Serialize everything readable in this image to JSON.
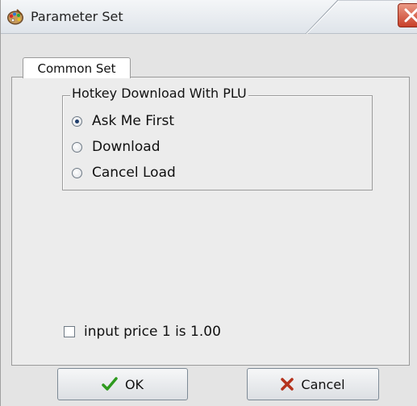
{
  "window": {
    "title": "Parameter Set",
    "app_icon": "palette-icon",
    "close_icon": "close-icon"
  },
  "tabs": [
    {
      "label": "Common Set",
      "active": true
    }
  ],
  "hotkey_group": {
    "legend": "Hotkey Download With PLU",
    "options": [
      {
        "label": "Ask Me First",
        "checked": true
      },
      {
        "label": "Download",
        "checked": false
      },
      {
        "label": "Cancel Load",
        "checked": false
      }
    ]
  },
  "input_price_option": {
    "label": "input price 1 is 1.00",
    "checked": false
  },
  "buttons": {
    "ok_label": "OK",
    "ok_icon": "checkmark-icon",
    "cancel_label": "Cancel",
    "cancel_icon": "x-icon"
  },
  "colors": {
    "ok_icon": "#2e9a1e",
    "cancel_icon": "#b5321c",
    "close_button": "#c8402a"
  }
}
